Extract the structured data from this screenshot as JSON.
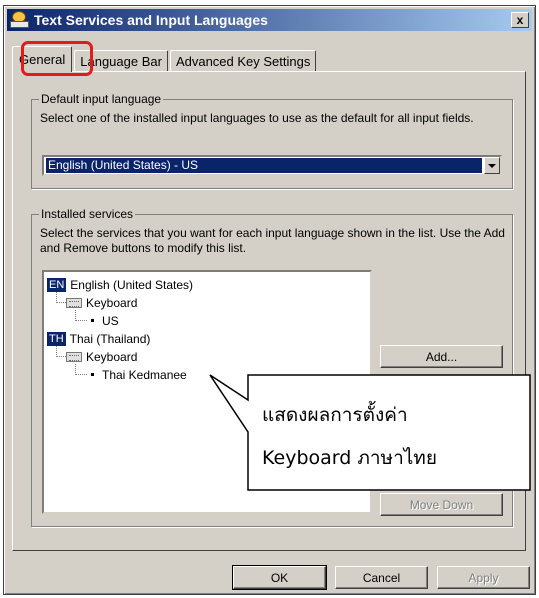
{
  "window": {
    "title": "Text Services and Input Languages",
    "close_label": "x"
  },
  "tabs": [
    {
      "label": "General",
      "active": true
    },
    {
      "label": "Language Bar",
      "active": false
    },
    {
      "label": "Advanced Key Settings",
      "active": false
    }
  ],
  "default_input": {
    "group_label": "Default input language",
    "description": "Select one of the installed input languages to use as the default for all input fields.",
    "selected_value": "English (United States) - US"
  },
  "installed_services": {
    "group_label": "Installed services",
    "description": "Select the services that you want for each input language shown in the list. Use the Add and Remove buttons to modify this list.",
    "tree": [
      {
        "badge": "EN",
        "language": "English (United States)",
        "category": "Keyboard",
        "layout": "US"
      },
      {
        "badge": "TH",
        "language": "Thai (Thailand)",
        "category": "Keyboard",
        "layout": "Thai Kedmanee"
      }
    ],
    "buttons": {
      "add": "Add...",
      "move_down": "Move Down"
    }
  },
  "footer": {
    "ok": "OK",
    "cancel": "Cancel",
    "apply": "Apply"
  },
  "callout": {
    "line1": "แสดงผลการตั้งค่า",
    "line2": "Keyboard ภาษาไทย"
  },
  "colors": {
    "highlight_border": "#e21b1b",
    "selection": "#0a246a",
    "dialog_face": "#d4d0c8"
  }
}
